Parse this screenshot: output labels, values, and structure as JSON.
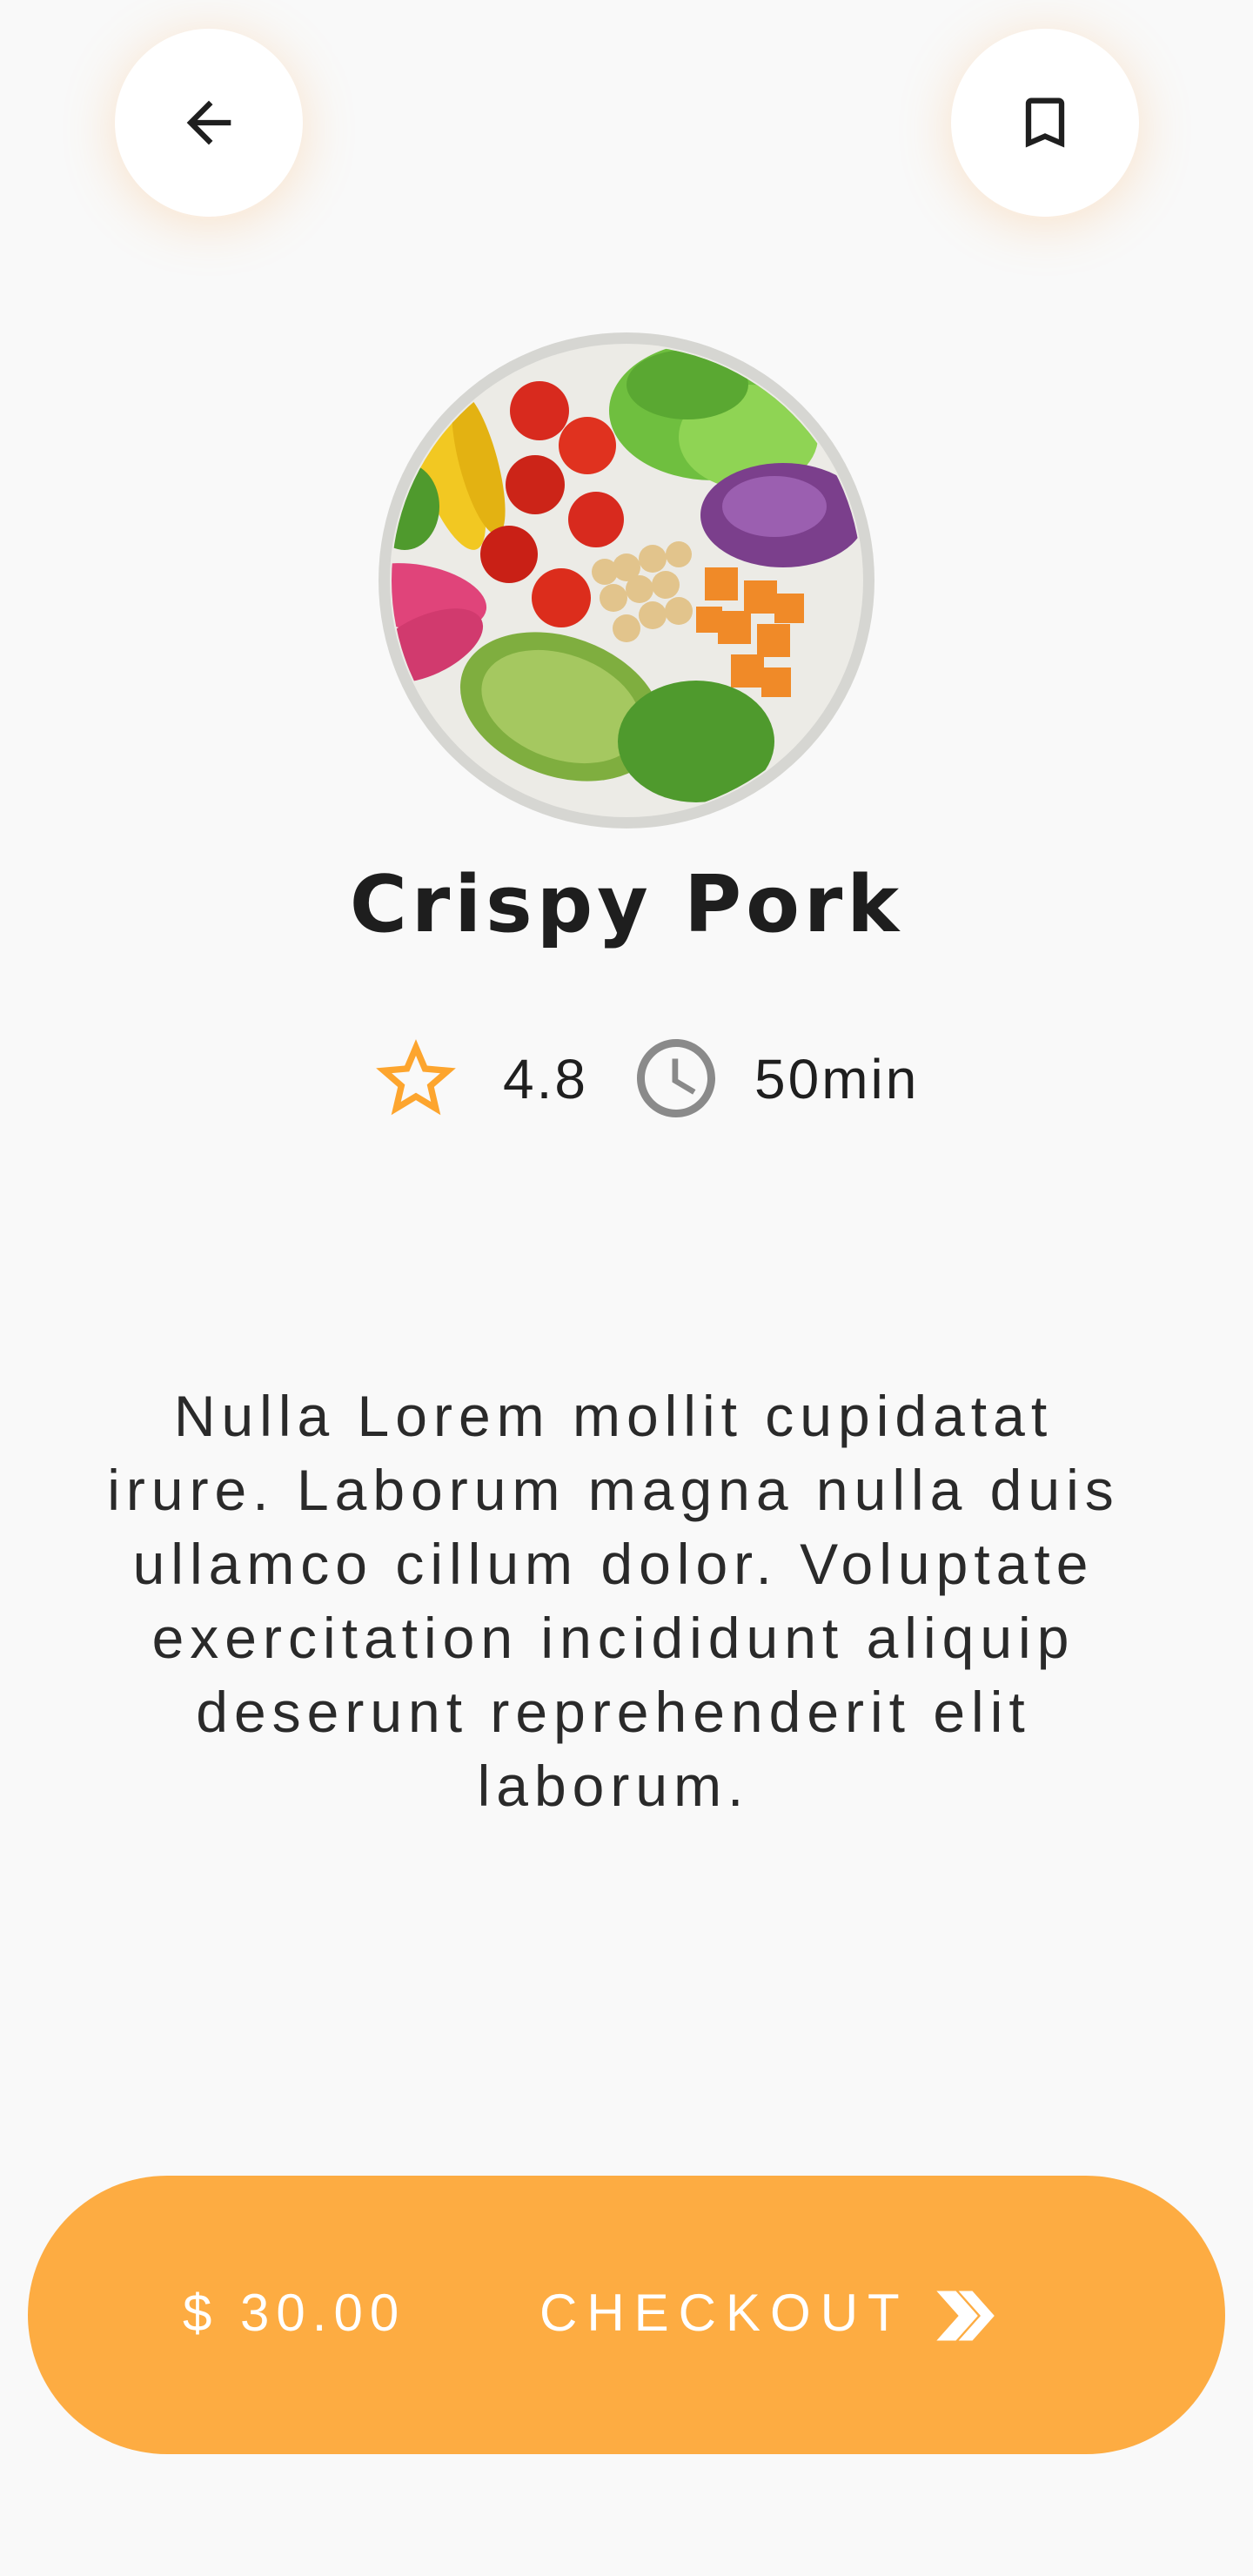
{
  "header": {
    "back_icon": "arrow-back-icon",
    "bookmark_icon": "bookmark-icon"
  },
  "dish": {
    "image": "salad-bowl-photo",
    "title": "Crispy Pork",
    "rating": "4.8",
    "time": "50min",
    "description": "Nulla Lorem mollit cupidatat\nirure.  Laborum magna nulla duis\nullamco cillum dolor.   Voluptate\nexercitation incididunt aliquip\ndeserunt reprehenderit elit\nlaborum."
  },
  "checkout": {
    "price": "$ 30.00",
    "label": "CHECKOUT",
    "icon": "double-chevron-right-icon"
  },
  "colors": {
    "accent": "#fdac42",
    "background": "#f9f9f9",
    "icon_gray": "#8a8a8a"
  }
}
